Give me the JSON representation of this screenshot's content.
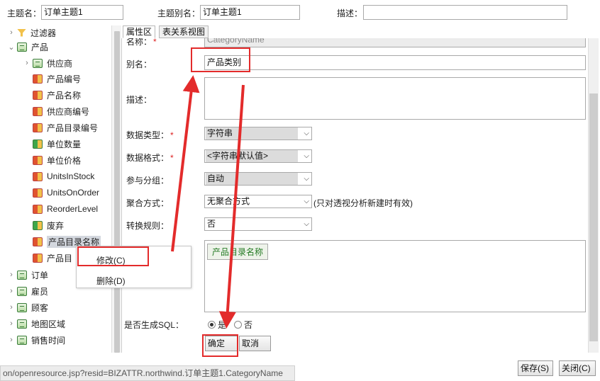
{
  "header": {
    "theme_name_label": "主题名：",
    "theme_name_value": "订单主题1",
    "theme_alias_label": "主题别名：",
    "theme_alias_value": "订单主题1",
    "description_label": "描述：",
    "description_value": ""
  },
  "tree": {
    "nodes": [
      {
        "label": "过滤器",
        "icon": "filter-icon"
      },
      {
        "label": "产品",
        "icon": "dimension-icon"
      },
      {
        "label": "供应商",
        "icon": "dimension-icon"
      },
      {
        "label": "产品编号",
        "icon": "attribute-icon"
      },
      {
        "label": "产品名称",
        "icon": "attribute-icon"
      },
      {
        "label": "供应商编号",
        "icon": "attribute-icon"
      },
      {
        "label": "产品目录编号",
        "icon": "attribute-icon"
      },
      {
        "label": "单位数量",
        "icon": "attribute-icon"
      },
      {
        "label": "单位价格",
        "icon": "attribute-icon"
      },
      {
        "label": "UnitsInStock",
        "icon": "attribute-icon"
      },
      {
        "label": "UnitsOnOrder",
        "icon": "attribute-icon"
      },
      {
        "label": "ReorderLevel",
        "icon": "attribute-icon"
      },
      {
        "label": "废弃",
        "icon": "attribute-icon"
      },
      {
        "label": "产品目录名称",
        "icon": "attribute-icon"
      },
      {
        "label": "产品目",
        "icon": "attribute-icon"
      },
      {
        "label": "订单",
        "icon": "dimension-icon"
      },
      {
        "label": "雇员",
        "icon": "dimension-icon"
      },
      {
        "label": "顾客",
        "icon": "dimension-icon"
      },
      {
        "label": "地图区域",
        "icon": "dimension-icon"
      },
      {
        "label": "销售时间",
        "icon": "dimension-icon"
      }
    ]
  },
  "context_menu": {
    "edit": "修改(C)",
    "delete": "删除(D)"
  },
  "tabs": {
    "properties": "属性区",
    "relations": "表关系视图"
  },
  "form": {
    "name_label": "名称：",
    "name_value": "CategoryName",
    "alias_label": "别名：",
    "alias_value": "产品类别",
    "desc_label": "描述：",
    "datatype_label": "数据类型：",
    "datatype_value": "字符串",
    "dataformat_label": "数据格式：",
    "dataformat_value": "<字符串默认值>",
    "grouping_label": "参与分组：",
    "grouping_value": "自动",
    "aggregation_label": "聚合方式：",
    "aggregation_value": "无聚合方式",
    "aggregation_hint": "(只对透视分析新建时有效)",
    "conversion_label": "转换规则：",
    "conversion_value": "否",
    "expression_chip": "产品目录名称",
    "gen_sql_label": "是否生成SQL：",
    "gen_sql_yes": "是",
    "gen_sql_no": "否",
    "ok_button": "确定(O)",
    "cancel_button": "取消(C)"
  },
  "footer": {
    "save_button": "保存(S)",
    "close_button": "关闭(C)",
    "status_url": "on/openresource.jsp?resid=BIZATTR.northwind.订单主题1.CategoryName"
  },
  "colors": {
    "annotation_red": "#e32b2b",
    "required_star": "#dd2222",
    "chip_text": "#237a23"
  }
}
